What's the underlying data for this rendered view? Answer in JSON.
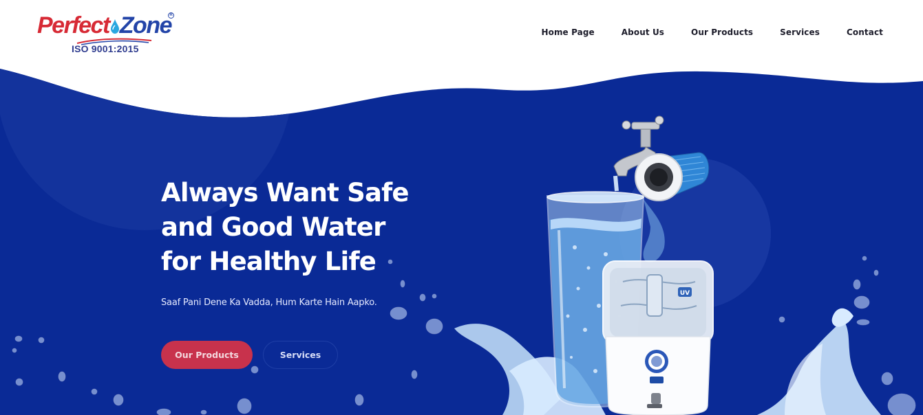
{
  "brand": {
    "name_part1": "Perfect",
    "name_part2": "Zone",
    "registered": "R",
    "certification": "ISO 9001:2015"
  },
  "nav": {
    "items": [
      {
        "label": "Home Page",
        "name": "nav-home"
      },
      {
        "label": "About Us",
        "name": "nav-about"
      },
      {
        "label": "Our Products",
        "name": "nav-products"
      },
      {
        "label": "Services",
        "name": "nav-services"
      },
      {
        "label": "Contact",
        "name": "nav-contact"
      }
    ]
  },
  "hero": {
    "headline_lines": [
      "Always Want Safe",
      "and Good Water",
      "for Healthy Life"
    ],
    "tagline": "Saaf Pani Dene Ka Vadda, Hum Karte Hain Aapko.",
    "primary_button": "Our Products",
    "secondary_button": "Services"
  },
  "purifier": {
    "badge_label": "UV"
  },
  "colors": {
    "hero_bg": "#0a2a96",
    "brand_red": "#d72a35",
    "brand_blue": "#2344a8",
    "button_red": "#c8324c"
  }
}
